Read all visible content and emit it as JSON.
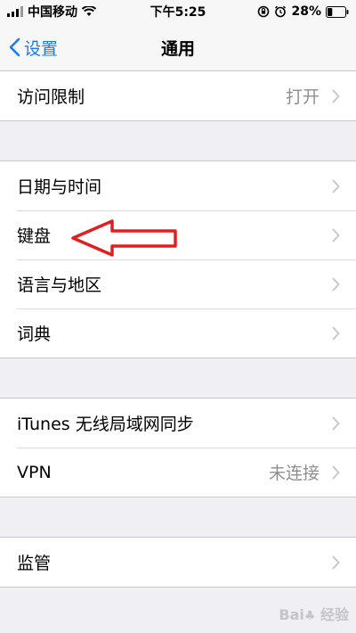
{
  "status_bar": {
    "carrier": "中国移动",
    "time": "下午5:25",
    "battery_percent": "28%",
    "battery_level": 0.28,
    "icons": [
      "signal-icon",
      "wifi-icon",
      "orientation-lock-icon",
      "alarm-icon",
      "battery-icon"
    ]
  },
  "nav": {
    "back_label": "设置",
    "title": "通用"
  },
  "groups": [
    {
      "rows": [
        {
          "label": "访问限制",
          "value": "打开"
        }
      ]
    },
    {
      "rows": [
        {
          "label": "日期与时间",
          "value": ""
        },
        {
          "label": "键盘",
          "value": ""
        },
        {
          "label": "语言与地区",
          "value": ""
        },
        {
          "label": "词典",
          "value": ""
        }
      ]
    },
    {
      "rows": [
        {
          "label": "iTunes 无线局域网同步",
          "value": ""
        },
        {
          "label": "VPN",
          "value": "未连接"
        }
      ]
    },
    {
      "rows": [
        {
          "label": "监管",
          "value": ""
        }
      ]
    }
  ],
  "annotation": {
    "color": "#e02020"
  },
  "colors": {
    "accent": "#1a7cf5",
    "background": "#efeff4",
    "chevron": "#c7c7cc"
  }
}
